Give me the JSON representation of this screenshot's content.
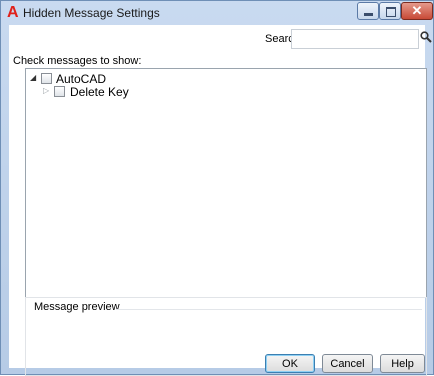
{
  "window": {
    "title": "Hidden Message Settings",
    "app_icon": "autocad-logo-icon"
  },
  "search": {
    "label": "Search:",
    "value": "",
    "placeholder": ""
  },
  "tree": {
    "heading": "Check messages to show:",
    "nodes": [
      {
        "label": "AutoCAD",
        "expanded": true,
        "checked": false
      },
      {
        "label": "Delete Key",
        "expanded": false,
        "checked": false
      }
    ]
  },
  "preview": {
    "legend": "Message preview",
    "content": ""
  },
  "buttons": {
    "ok": "OK",
    "cancel": "Cancel",
    "help": "Help"
  }
}
